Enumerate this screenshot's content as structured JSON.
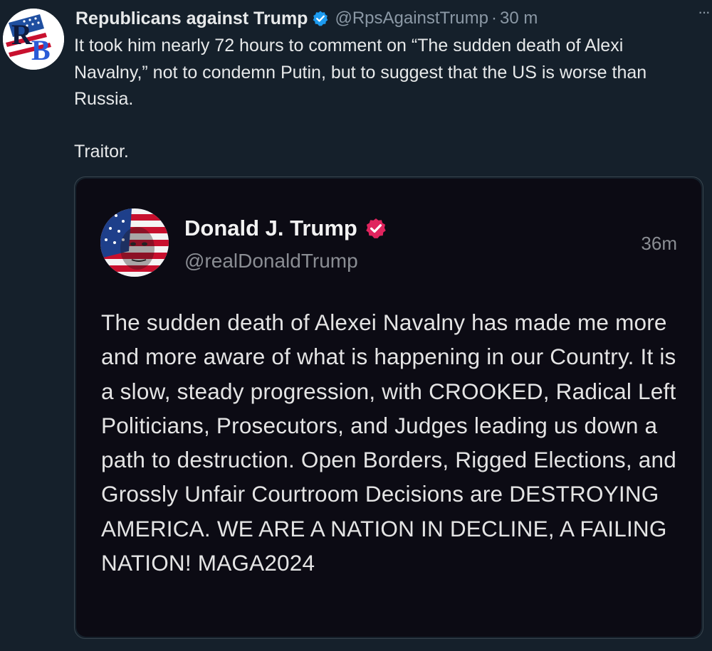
{
  "post": {
    "author_name": "Republicans against Trump",
    "author_handle": "@RpsAgainstTrump",
    "separator": "·",
    "timestamp": "30 m",
    "more_label": "···",
    "text_lines": "It took him nearly 72 hours to comment on “The sudden death of Alexi Navalny,” not to condemn Putin, but to suggest that the US is worse than Russia.",
    "text_second": "Traitor.",
    "avatar_icon": "rb-logo-icon",
    "badge_icon": "verified-badge-icon",
    "badge_color": "#1d9bf0"
  },
  "embedded": {
    "author_name": "Donald J. Trump",
    "author_handle": "@realDonaldTrump",
    "timestamp": "36m",
    "badge_color": "#e0245e",
    "body": "The sudden death of Alexei Navalny has made me more and more aware of what is happening in our Country. It is a slow, steady progression, with CROOKED, Radical Left Politicians, Prosecutors, and Judges leading us down a path to destruction. Open Borders, Rigged Elections, and Grossly Unfair Courtroom Decisions are DESTROYING AMERICA. WE ARE A NATION IN DECLINE, A FAILING NATION! MAGA2024"
  },
  "colors": {
    "background": "#15202b",
    "text": "#e7e9ea",
    "secondary": "#8b98a5",
    "card_bg": "#0c0b14"
  }
}
